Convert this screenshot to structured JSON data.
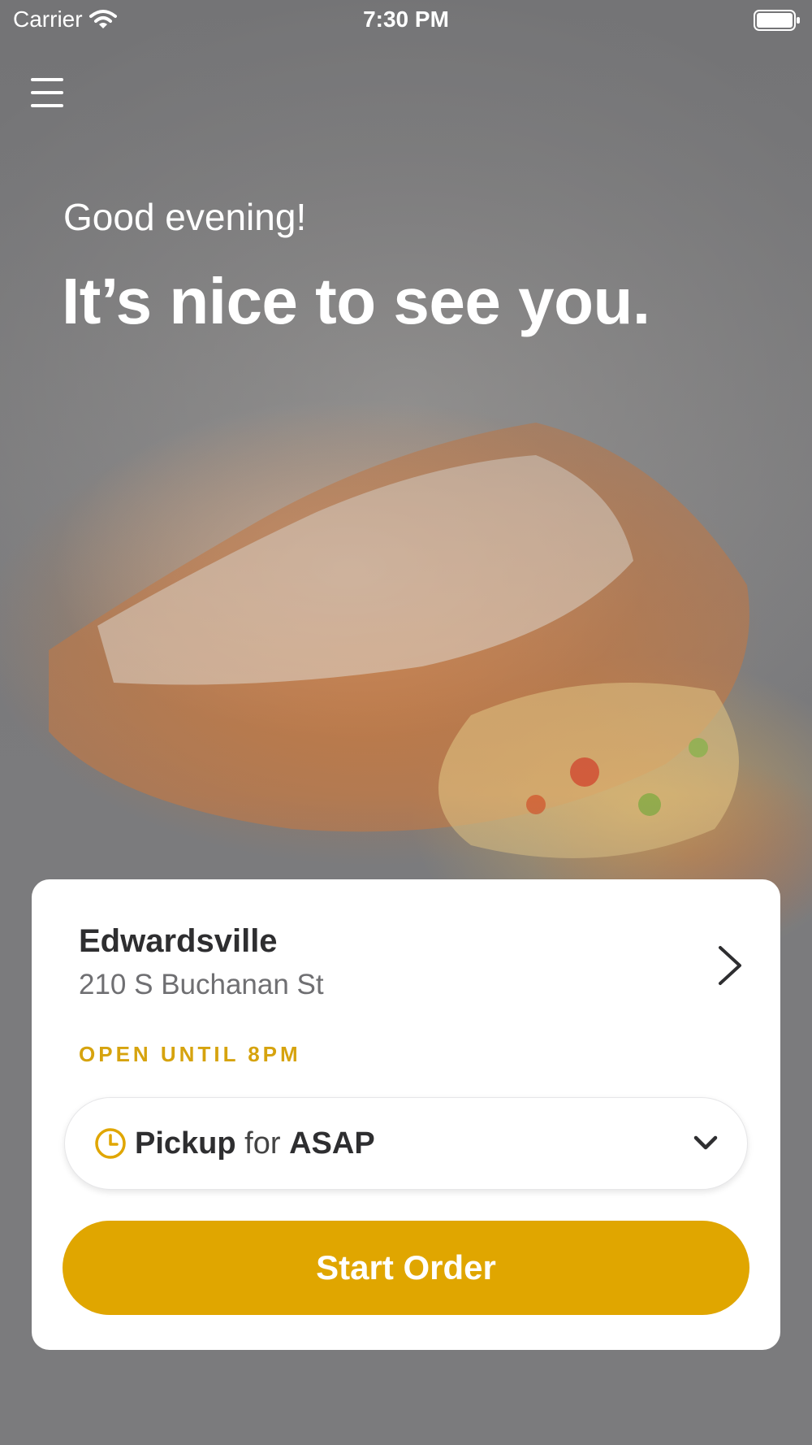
{
  "status_bar": {
    "carrier": "Carrier",
    "time": "7:30 PM"
  },
  "icons": {
    "menu": "hamburger-menu-icon",
    "wifi": "wifi-icon",
    "battery": "battery-icon",
    "clock": "clock-icon",
    "chevron_right": "chevron-right-icon",
    "chevron_down": "chevron-down-icon"
  },
  "hero": {
    "greeting": "Good evening!",
    "headline": "It’s nice to see you."
  },
  "location": {
    "name": "Edwardsville",
    "address": "210 S Buchanan St",
    "hours": "OPEN UNTIL 8PM"
  },
  "order_mode": {
    "mode": "Pickup",
    "connector": "for",
    "time": "ASAP"
  },
  "start_button": {
    "label": "Start Order"
  },
  "colors": {
    "accent": "#e0a600",
    "hours_text": "#d6a30e",
    "background": "#7b7b7d",
    "card": "#ffffff"
  }
}
